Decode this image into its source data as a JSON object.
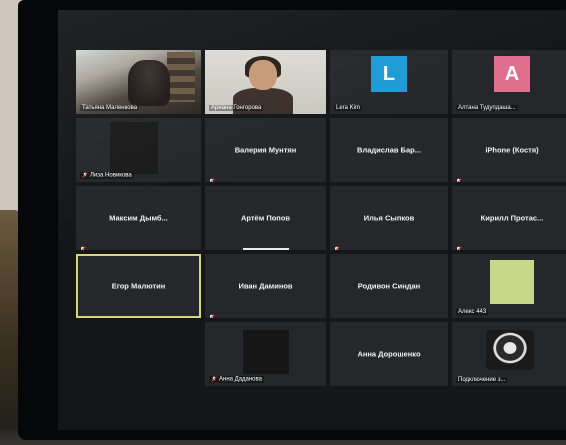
{
  "participants": [
    {
      "name": "Татьяна Маленкова",
      "type": "video1"
    },
    {
      "name": "Ариана Гонгорова",
      "type": "video2"
    },
    {
      "name": "Lera Kim",
      "type": "avatar",
      "initial": "L",
      "color": "#1d9bd6"
    },
    {
      "name": "Алтана Тудупдаша...",
      "type": "avatar",
      "initial": "A",
      "color": "#e06e8c"
    },
    {
      "name": "Лиза Новикова",
      "type": "dark",
      "muted": true
    },
    {
      "name": "Валерия Мунтян",
      "type": "text",
      "muted": true
    },
    {
      "name": "Владислав Бар...",
      "type": "text"
    },
    {
      "name": "iPhone (Костя)",
      "type": "text",
      "muted": true
    },
    {
      "name": "Максим Дымб...",
      "type": "text",
      "muted": true
    },
    {
      "name": "Артём Попов",
      "type": "text",
      "speaking": true
    },
    {
      "name": "Илья Сыпков",
      "type": "text",
      "muted": true
    },
    {
      "name": "Кирилл Протас...",
      "type": "text",
      "muted": true
    },
    {
      "name": "Егор Малютин",
      "type": "text",
      "active": true
    },
    {
      "name": "Иван Даминов",
      "type": "text",
      "muted": true
    },
    {
      "name": "Родивон Синдан",
      "type": "text"
    },
    {
      "name": "Алекс 443",
      "type": "green"
    },
    {
      "name": "",
      "type": "empty"
    },
    {
      "name": "Анна Даданова",
      "type": "darkbox",
      "muted": true
    },
    {
      "name": "Анна Дорошенко",
      "type": "text"
    },
    {
      "name": "Подключение з...",
      "type": "logo"
    }
  ]
}
